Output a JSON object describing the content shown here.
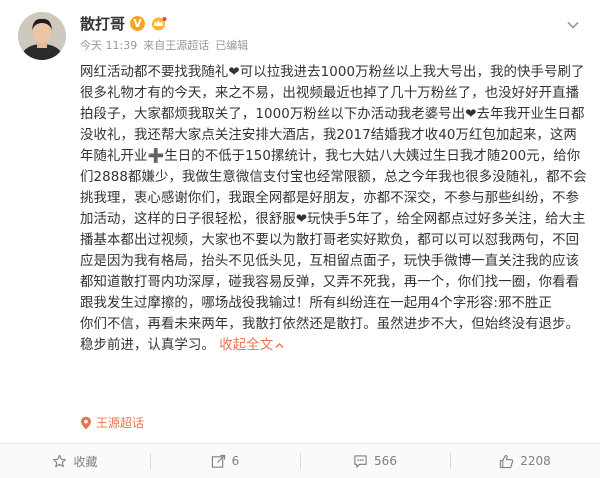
{
  "post": {
    "username": "散打哥",
    "verified_badge": "V",
    "meta_time": "今天 11:39",
    "meta_source_prefix": "来自",
    "meta_source": "王源超话",
    "meta_edited": "已编辑",
    "body_lines": [
      "网红活动都不要找我随礼❤可以拉我进去1000万粉丝以上我大号出，我的快手号刷了很多礼物才有的今天，来之不易，出视频最近也掉了几十万粉丝了，也没好好开直播拍段子，大家都烦我取关了，1000万粉丝以下办活动我老婆号出❤去年我开业生日都没收礼，我还帮大家点关注安排大酒店，我2017结婚我才收40万红包加起来，这两年随礼开业➕生日的不低于150摞统计，我七大姑八大姨过生日我才随200元，给你们2888都嫌少，我做生意微信支付宝也经常限额，总之今年我也很多没随礼，都不会挑我理，衷心感谢你们，我跟全网都是好朋友，亦都不深交，不参与那些纠纷，不参加活动，这样的日子很轻松，很舒服❤玩快手5年了，给全网都点过好多关注，给大主播基本都出过视频，大家也不要以为散打哥老实好欺负，都可以可以怼我两句，不回应是因为我有格局，抬头不见低头见，互相留点面子，玩快手微博一直关注我的应该都知道散打哥内功深厚，碰我容易反弹，又弄不死我，再一个，你们找一圈，你看看跟我发生过摩擦的，哪场战役我输过！所有纠纷连在一起用4个字形容:邪不胜正",
      "你们不信，再看未来两年，我散打依然还是散打。虽然进步不大，但始终没有退步。稳步前进，认真学习。"
    ],
    "collapse_label": "收起全文",
    "location_label": "王源超话"
  },
  "actions": {
    "favorite_label": "收藏",
    "share_count": "6",
    "comment_count": "566",
    "like_count": "2208"
  },
  "colors": {
    "accent": "#eb7350",
    "text": "#333333",
    "meta": "#999999",
    "badge": "#f5a623"
  },
  "icons": [
    "chevron-down-icon",
    "verified-badge-icon",
    "crown-badge-icon",
    "location-pin-icon",
    "favorite-icon",
    "share-icon",
    "comment-icon",
    "like-icon"
  ]
}
